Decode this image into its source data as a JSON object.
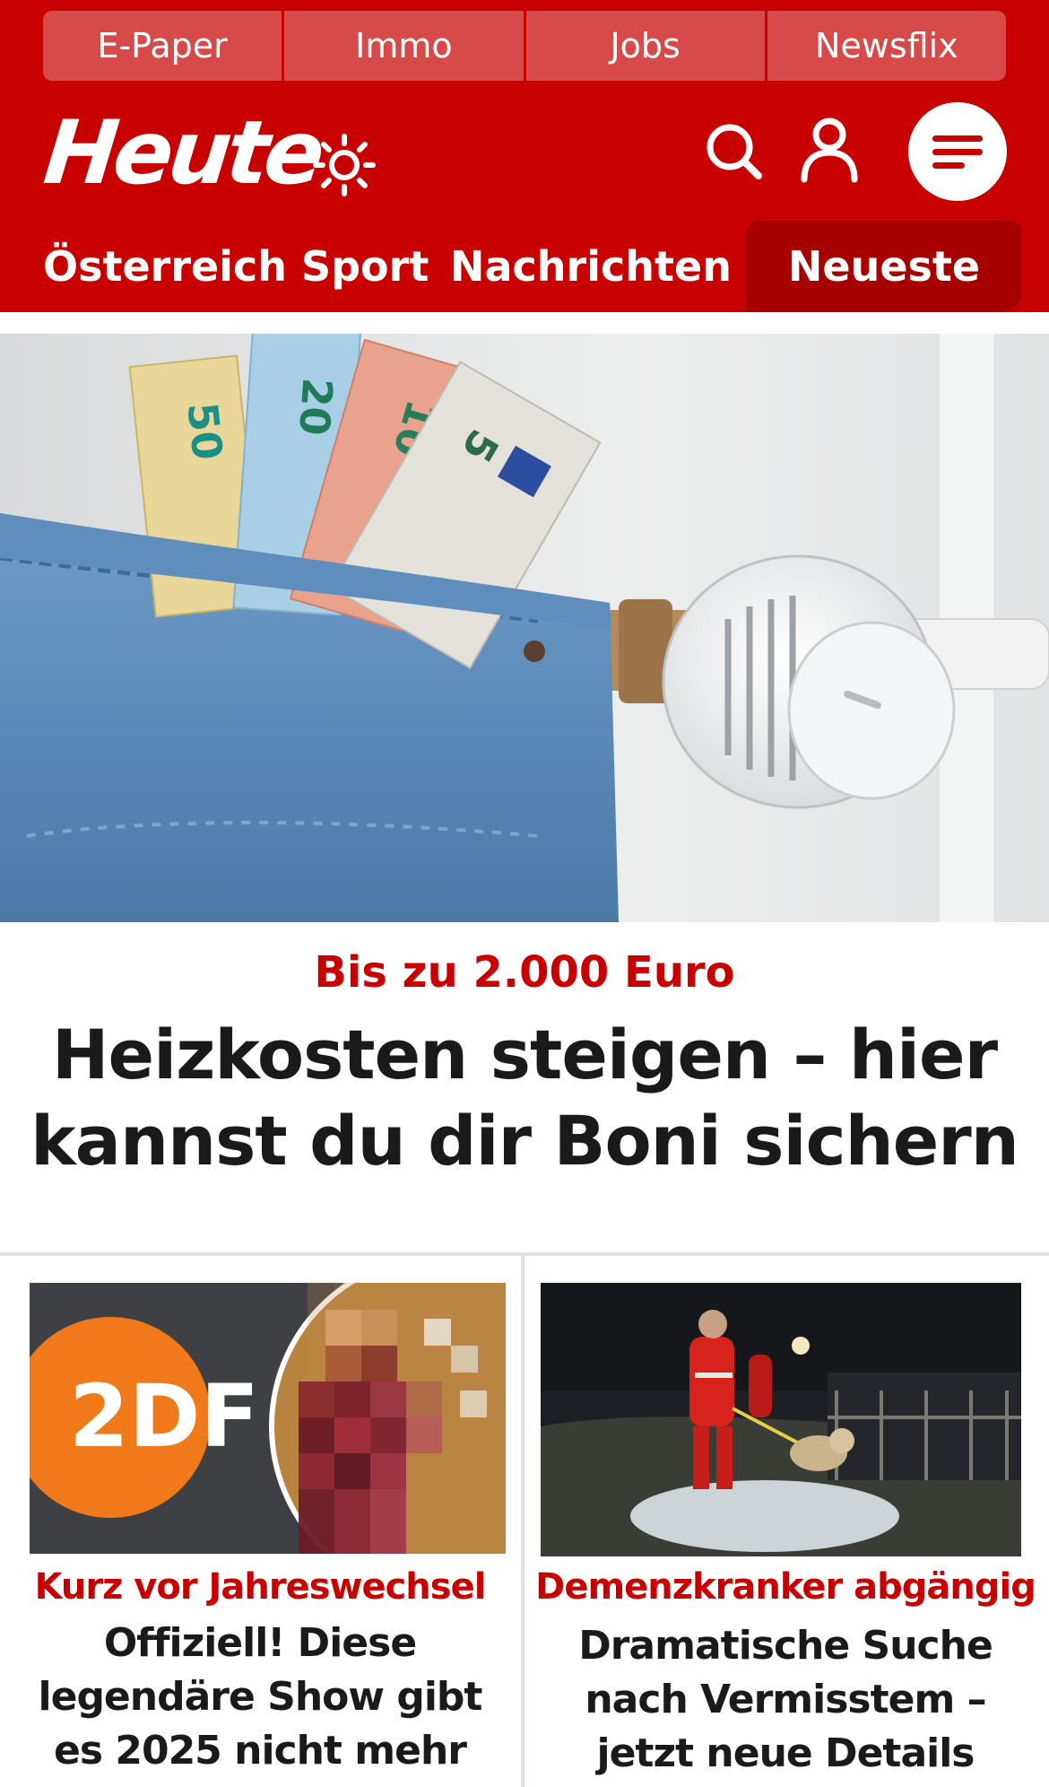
{
  "quick_links": [
    "E-Paper",
    "Immo",
    "Jobs",
    "Newsflix"
  ],
  "header": {
    "logo_text": "Heute",
    "icons": [
      "sun-icon",
      "search-icon",
      "user-icon",
      "menu-icon"
    ]
  },
  "nav": {
    "items": [
      "Österreich",
      "Sport",
      "Nachrichten"
    ],
    "latest": "Neueste"
  },
  "hero": {
    "kicker": "Bis zu 2.000 Euro",
    "title": "Heizkosten steigen – hier kannst du dir Boni sichern"
  },
  "teasers": [
    {
      "kicker": "Kurz vor Jahreswechsel",
      "title": "Offiziell! Diese legendäre Show gibt es 2025 nicht mehr",
      "image_logo": "2DF"
    },
    {
      "kicker": "Demenzkranker abgängig",
      "title": "Dramatische Suche nach Vermisstem – jetzt neue Details"
    }
  ],
  "colors": {
    "brand_red": "#c80000",
    "quick_link_bg": "#d74a4a",
    "latest_bg": "#a60000",
    "headline": "#1a1a1a"
  }
}
